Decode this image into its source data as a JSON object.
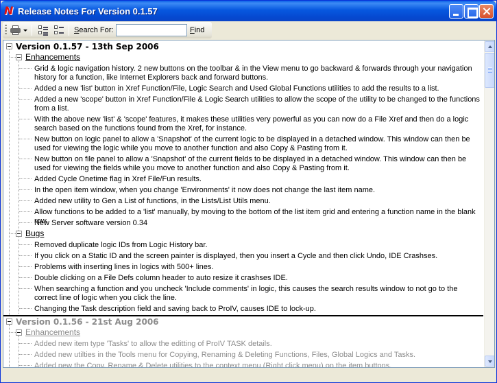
{
  "window": {
    "title": "Release Notes For Version 0.1.57",
    "app_icon": "N"
  },
  "toolbar": {
    "search_label": "Search For:",
    "search_label_mnemonic": "S",
    "search_label_rest": "earch For:",
    "search_value": "",
    "find_label": "Find",
    "find_mnemonic": "F",
    "find_rest": "ind",
    "icons": [
      "printer-icon",
      "dropdown-arrow-icon",
      "expand-tree-icon",
      "collapse-tree-icon"
    ]
  },
  "versions": [
    {
      "title": "Version 0.1.57 - 13th Sep 2006",
      "sections": [
        {
          "name": "Enhancements",
          "items": [
            "Grid & logic navigation history. 2 new buttons on the toolbar & in the View menu to go backward & forwards through your navigation history for a function, like Internet Explorers back and forward buttons.",
            "Added a new 'list' button in Xref Function/File, Logic Search and Used Global Functions utilities to add the results to a list.",
            "Added a new 'scope' button in Xref Function/File & Logic Search utilities to allow the scope of the utility to be changed to the functions from a list.",
            "With the above new 'list' & 'scope' features, it makes these utilities very powerful as you can now do a File Xref and then do a logic search based on the functions found from the Xref, for instance.",
            "New button on logic panel to allow a 'Snapshot' of the current logic to be displayed in a detached window. This window can then be used for viewing the logic while you move to another function and also Copy & Pasting from it.",
            "New button on file panel to allow a 'Snapshot' of the current fields to be displayed in a detached window. This window can then be used for viewing the fields while you move to another function and also Copy & Pasting from it.",
            "Added Cycle Onetime flag in Xref File/Fun results.",
            "In the open item window, when you change 'Environments' it now does not change the last item name.",
            "Added new utility to Gen a List of functions, in the Lists/List Utils menu.",
            "Allow functions to be added to a 'list' manually, by moving to the bottom of the list item grid and entering a function name in the blank row.",
            "New Server software version 0.34"
          ]
        },
        {
          "name": "Bugs",
          "items": [
            "Removed duplicate logic IDs from Logic History bar.",
            "If you click on a Static ID and the screen painter is displayed, then you insert a Cycle and then click Undo, IDE Crashses.",
            "Problems with inserting lines in logics with 500+ lines.",
            "Double clicking on a File Defs column header to auto resize it crashses IDE.",
            "When searching a function and you uncheck 'Include comments' in logic, this causes the search results window to not go to the correct line of logic when you click the line.",
            "Changing the Task description field and saving back to ProIV, causes IDE to lock-up."
          ]
        }
      ]
    },
    {
      "title": "Version 0.1.56 - 21st Aug 2006",
      "sections": [
        {
          "name": "Enhancements",
          "items": [
            "Added new item type 'Tasks' to allow the editting of ProIV TASK details.",
            "Added new utilties in the Tools menu for Copying, Renaming & Deleting Functions, Files, Global Logics and Tasks.",
            "Added new the Copy, Rename & Delete utilities to the context menu (Right click menu) on the item buttons."
          ]
        }
      ]
    }
  ]
}
